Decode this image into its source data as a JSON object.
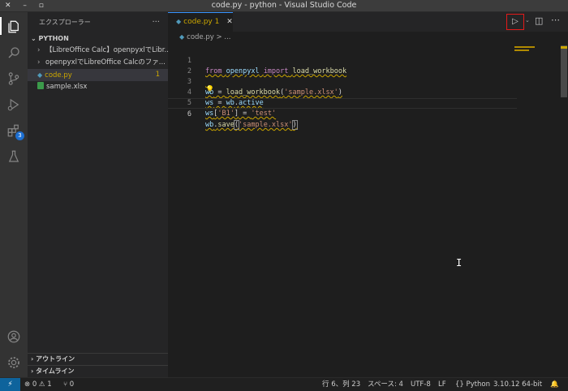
{
  "window": {
    "title": "code.py - python - Visual Studio Code",
    "controls": "✕ – ▫"
  },
  "activity_bar": {
    "extensions_badge": "3"
  },
  "sidebar": {
    "header": "エクスプローラー",
    "more": "···",
    "folder": "PYTHON",
    "items": [
      {
        "label": "【LibreOffice Calc】openpyxlでLibr..."
      },
      {
        "label": "openpyxlでLibreOffice Calcのファ..."
      },
      {
        "label": "code.py",
        "problems": "1"
      },
      {
        "label": "sample.xlsx"
      }
    ],
    "outline": "アウトライン",
    "timeline": "タイムライン"
  },
  "editor": {
    "tab": {
      "label": "code.py",
      "problems": "1",
      "close": "✕"
    },
    "breadcrumb": "code.py > ...",
    "lines": [
      {
        "n": "1"
      },
      {
        "n": "2"
      },
      {
        "n": "3"
      },
      {
        "n": "4"
      },
      {
        "n": "5"
      },
      {
        "n": "6"
      }
    ],
    "code": {
      "l1_from": "from",
      "l1_mod": "openpyxl",
      "l1_import": "import",
      "l1_name": "load_workbook",
      "l3_wb": "wb",
      "l3_eq": " = ",
      "l3_fn": "load_workbook",
      "l3_open": "(",
      "l3_str": "'sample.xlsx'",
      "l3_close": ")",
      "l4_ws": "ws",
      "l4_eq": " = ",
      "l4_wb": "wb",
      "l4_dot": ".",
      "l4_attr": "active",
      "l5_ws": "ws",
      "l5_open": "[",
      "l5_key": "'B1'",
      "l5_close": "]",
      "l5_eq": " = ",
      "l5_val": "'test'",
      "l6_wb": "wb",
      "l6_dot": ".",
      "l6_fn": "save",
      "l6_open": "(",
      "l6_str": "'sample.xlsx'",
      "l6_close": ")"
    }
  },
  "statusbar": {
    "errors": "⊗ 0 ⚠ 1",
    "ports": "⑂ 0",
    "position": "行 6、列 23",
    "spaces": "スペース: 4",
    "encoding": "UTF-8",
    "eol": "LF",
    "language": "Python",
    "interpreter": "3.10.12 64-bit"
  }
}
